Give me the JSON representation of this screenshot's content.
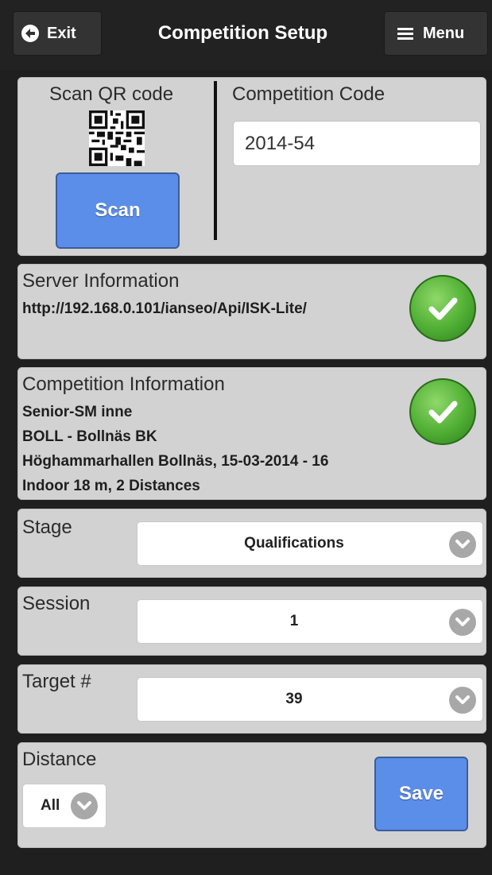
{
  "header": {
    "exit_label": "Exit",
    "title": "Competition Setup",
    "menu_label": "Menu"
  },
  "qr_section": {
    "scan_label": "Scan QR code",
    "scan_button": "Scan",
    "code_label": "Competition Code",
    "code_value": "2014-54"
  },
  "server": {
    "label": "Server Information",
    "url": "http://192.168.0.101/ianseo/Api/ISK-Lite/",
    "status_icon": "check-icon"
  },
  "competition": {
    "label": "Competition Information",
    "lines": [
      "Senior-SM inne",
      "BOLL - Bollnäs BK",
      "Höghammarhallen Bollnäs, 15-03-2014 - 16",
      "Indoor 18 m, 2 Distances"
    ],
    "status_icon": "check-icon"
  },
  "stage": {
    "label": "Stage",
    "value": "Qualifications"
  },
  "session": {
    "label": "Session",
    "value": "1"
  },
  "target": {
    "label": "Target #",
    "value": "39"
  },
  "distance": {
    "label": "Distance",
    "value": "All"
  },
  "save_button": "Save",
  "colors": {
    "accent_button": "#5b8ee8",
    "success": "#4fae33",
    "panel": "#d2d2d2",
    "background": "#1f1f1f"
  }
}
